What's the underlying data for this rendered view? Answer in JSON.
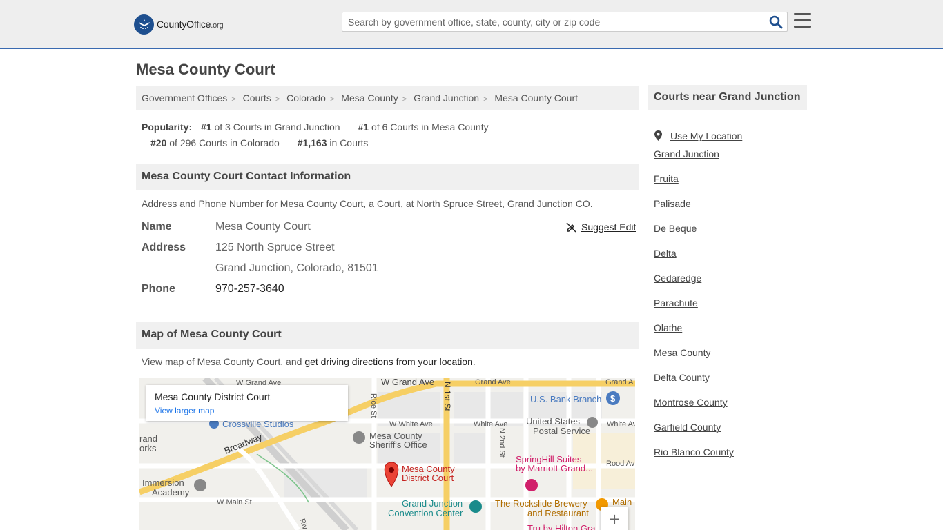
{
  "header": {
    "logo_text": "CountyOffice",
    "logo_suffix": ".org",
    "search_placeholder": "Search by government office, state, county, city or zip code"
  },
  "page_title": "Mesa County Court",
  "breadcrumb": [
    "Government Offices",
    "Courts",
    "Colorado",
    "Mesa County",
    "Grand Junction",
    "Mesa County Court"
  ],
  "popularity": {
    "label": "Popularity:",
    "items": [
      {
        "rank": "#1",
        "text": "of 3 Courts in Grand Junction"
      },
      {
        "rank": "#1",
        "text": "of 6 Courts in Mesa County"
      },
      {
        "rank": "#20",
        "text": "of 296 Courts in Colorado"
      },
      {
        "rank": "#1,163",
        "text": "in Courts"
      }
    ]
  },
  "contact": {
    "heading": "Mesa County Court Contact Information",
    "description": "Address and Phone Number for Mesa County Court, a Court, at North Spruce Street, Grand Junction CO.",
    "suggest_edit": "Suggest Edit",
    "name_label": "Name",
    "name": "Mesa County Court",
    "address_label": "Address",
    "address_line1": "125 North Spruce Street",
    "address_line2": "Grand Junction, Colorado, 81501",
    "phone_label": "Phone",
    "phone": "970-257-3640"
  },
  "map_section": {
    "heading": "Map of Mesa County Court",
    "description_prefix": "View map of Mesa County Court, and ",
    "directions_link": "get driving directions from your location",
    "description_suffix": ".",
    "card_title": "Mesa County District Court",
    "card_link": "View larger map",
    "zoom_in": "+",
    "labels": {
      "grand_ave_1": "W Grand Ave",
      "grand_ave_2": "W Grand Ave",
      "grand_ave_3": "Grand Ave",
      "grand_ave_4": "Grand A",
      "n1st": "N 1st St",
      "rice": "Rice St",
      "white_1": "W White Ave",
      "white_2": "White Ave",
      "white_3": "White Av",
      "n2nd": "N 2nd St",
      "rood": "Rood Av",
      "main": "W Main St",
      "main2": "Main",
      "broadway": "Broadway",
      "usbank": "U.S. Bank Branch",
      "usps1": "United States",
      "usps2": "Postal Service",
      "crossville": "Crossville Studios",
      "sheriff1": "Mesa County",
      "sheriff2": "Sheriff's Office",
      "court1": "Mesa County",
      "court2": "District Court",
      "springhill1": "SpringHill Suites",
      "springhill2": "by Marriott Grand...",
      "immersion1": "Immersion",
      "immersion2": "Academy",
      "convention1": "Grand Junction",
      "convention2": "Convention Center",
      "rockslide1": "The Rockslide Brewery",
      "rockslide2": "and Restaurant",
      "tru": "Tru by Hilton Gra",
      "grand_works1": "rand",
      "grand_works2": "orks",
      "riv": "Riv"
    }
  },
  "sidebar": {
    "heading": "Courts near Grand Junction",
    "use_location": "Use My Location",
    "links": [
      "Grand Junction",
      "Fruita",
      "Palisade",
      "De Beque",
      "Delta",
      "Cedaredge",
      "Parachute",
      "Olathe",
      "Mesa County",
      "Delta County",
      "Montrose County",
      "Garfield County",
      "Rio Blanco County"
    ]
  },
  "colors": {
    "header_bg": "#eeeeee",
    "header_border": "#3a6ab0",
    "section_bg": "#f0f0f0",
    "map_road_major": "#f6cf65",
    "map_marker": "#ea4335",
    "map_link": "#1a73e8"
  }
}
